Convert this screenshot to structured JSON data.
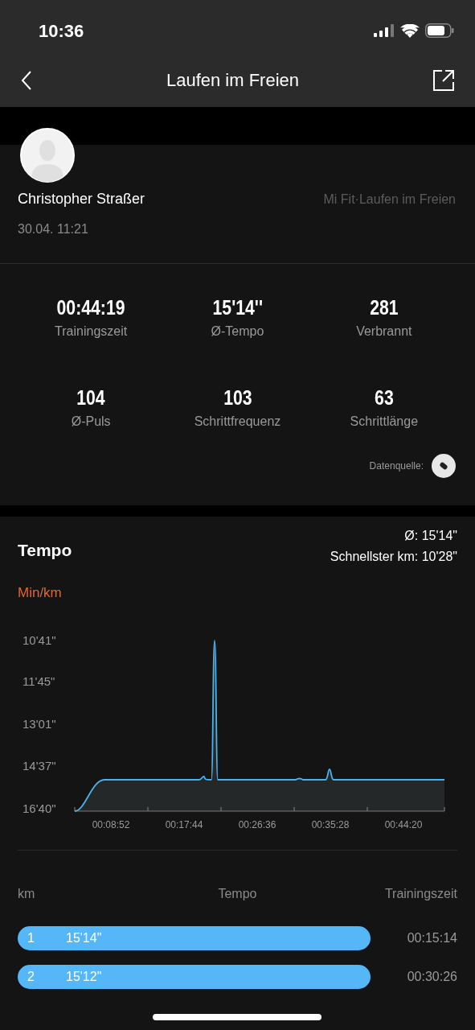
{
  "status_bar": {
    "time": "10:36"
  },
  "nav": {
    "title": "Laufen im Freien"
  },
  "profile": {
    "name": "Christopher Straßer",
    "date": "30.04. 11:21",
    "source": "Mi Fit·Laufen im Freien"
  },
  "stats": [
    {
      "value": "00:44:19",
      "label": "Trainingszeit"
    },
    {
      "value": "15'14''",
      "label": "Ø-Tempo"
    },
    {
      "value": "281",
      "label": "Verbrannt"
    },
    {
      "value": "104",
      "label": "Ø-Puls"
    },
    {
      "value": "103",
      "label": "Schrittfrequenz"
    },
    {
      "value": "63",
      "label": "Schrittlänge"
    }
  ],
  "data_source": {
    "label": "Datenquelle:"
  },
  "tempo": {
    "title": "Tempo",
    "average": "Ø: 15'14\"",
    "fastest": "Schnellster km: 10'28\"",
    "unit": "Min/km",
    "y_labels": [
      "10'41\"",
      "11'45\"",
      "13'01\"",
      "14'37\"",
      "16'40\""
    ],
    "x_labels": [
      "00:08:52",
      "00:17:44",
      "00:26:36",
      "00:35:28",
      "00:44:20"
    ]
  },
  "splits": {
    "columns": [
      "km",
      "Tempo",
      "Trainingszeit"
    ],
    "rows": [
      {
        "km": "1",
        "tempo": "15'14\"",
        "time": "00:15:14"
      },
      {
        "km": "2",
        "tempo": "15'12\"",
        "time": "00:30:26"
      }
    ]
  }
}
